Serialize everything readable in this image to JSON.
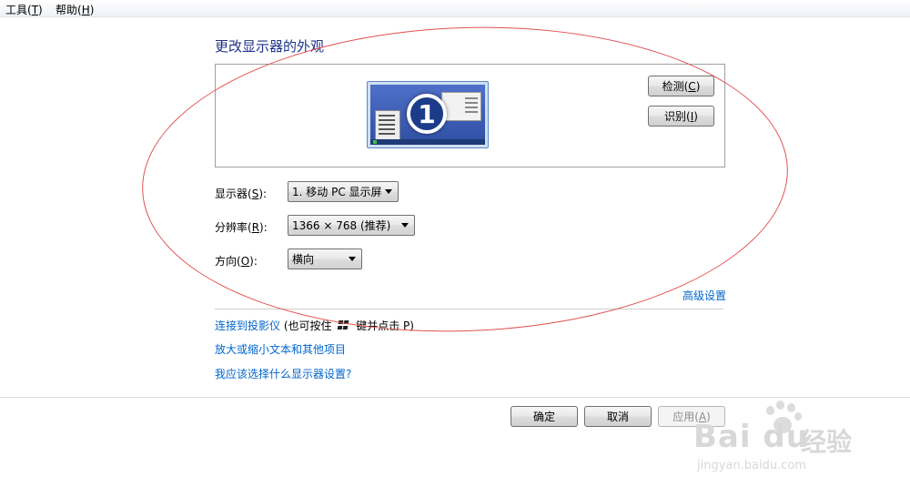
{
  "menubar": {
    "tools": {
      "text": "工具(",
      "key": "T",
      "end": ")"
    },
    "help": {
      "text": "帮助(",
      "key": "H",
      "end": ")"
    }
  },
  "page_title": "更改显示器的外观",
  "preview": {
    "monitor_number": "1",
    "detect_button": {
      "text": "检测(",
      "key": "C",
      "end": ")"
    },
    "identify_button": {
      "text": "识别(",
      "key": "I",
      "end": ")"
    }
  },
  "settings": {
    "display": {
      "label": "显示器(",
      "key": "S",
      "end": "):",
      "value": "1. 移动 PC 显示屏"
    },
    "resolution": {
      "label": "分辨率(",
      "key": "R",
      "end": "):",
      "value": "1366 × 768 (推荐)"
    },
    "orientation": {
      "label": "方向(",
      "key": "O",
      "end": "):",
      "value": "横向"
    }
  },
  "advanced_link": "高级设置",
  "links": {
    "projector": "连接到投影仪",
    "projector_hint_pre": "(也可按住",
    "projector_hint_post": "键并点击 P)",
    "text_size": "放大或缩小文本和其他项目",
    "which_settings": "我应该选择什么显示器设置?"
  },
  "footer": {
    "ok": "确定",
    "cancel": "取消",
    "apply": {
      "text": "应用(",
      "key": "A",
      "end": ")"
    }
  },
  "watermark": {
    "brand": "Bai du",
    "cn": "经验",
    "url": "jingyan.baidu.com"
  },
  "colors": {
    "title": "#1e3287",
    "link": "#0066cc",
    "annotation": "#e05252"
  }
}
